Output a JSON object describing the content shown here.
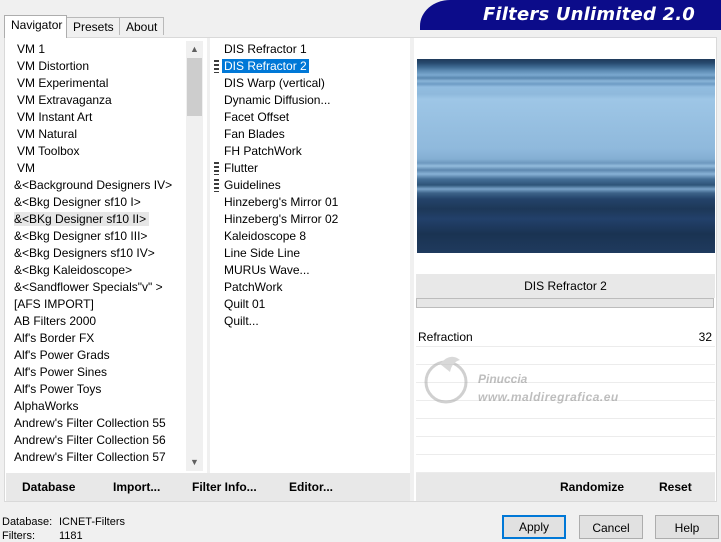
{
  "banner": {
    "title": "Filters Unlimited 2.0"
  },
  "tabs": [
    {
      "label": "Navigator"
    },
    {
      "label": "Presets"
    },
    {
      "label": "About"
    }
  ],
  "categories": [
    "VM 1",
    "VM Distortion",
    "VM Experimental",
    "VM Extravaganza",
    "VM Instant Art",
    "VM Natural",
    "VM Toolbox",
    "VM",
    "&<Background Designers IV>",
    "&<Bkg Designer sf10 I>",
    "&<BKg Designer sf10 II>",
    "&<Bkg Designer sf10 III>",
    "&<Bkg Designers sf10 IV>",
    "&<Bkg Kaleidoscope>",
    "&<Sandflower Specials\"v\" >",
    "[AFS IMPORT]",
    "AB Filters 2000",
    "Alf's Border FX",
    "Alf's Power Grads",
    "Alf's Power Sines",
    "Alf's Power Toys",
    "AlphaWorks",
    "Andrew's Filter Collection 55",
    "Andrew's Filter Collection 56",
    "Andrew's Filter Collection 57"
  ],
  "selected_category": "&<BKg Designer sf10 II>",
  "filters": [
    "DIS Refractor 1",
    "DIS Refractor 2",
    "DIS Warp (vertical)",
    "Dynamic Diffusion...",
    "Facet Offset",
    "Fan Blades",
    "FH PatchWork",
    "Flutter",
    "Guidelines",
    "Hinzeberg's Mirror 01",
    "Hinzeberg's Mirror 02",
    "Kaleidoscope 8",
    "Line Side Line",
    "MURUs Wave...",
    "PatchWork",
    "Quilt 01",
    "Quilt..."
  ],
  "selected_filter": "DIS Refractor 2",
  "effect_name": "DIS Refractor 2",
  "parameters": [
    {
      "name": "Refraction",
      "value": "32"
    }
  ],
  "watermark": {
    "line1": "Pinuccia",
    "line2": "www.maldiregrafica.eu"
  },
  "left_buttons": {
    "database": "Database",
    "import": "Import...",
    "filter_info": "Filter Info...",
    "editor": "Editor..."
  },
  "right_buttons": {
    "randomize": "Randomize",
    "reset": "Reset"
  },
  "status": {
    "database_label": "Database:",
    "database_value": "ICNET-Filters",
    "filters_label": "Filters:",
    "filters_value": "1181"
  },
  "dialog_buttons": {
    "apply": "Apply",
    "cancel": "Cancel",
    "help": "Help"
  }
}
